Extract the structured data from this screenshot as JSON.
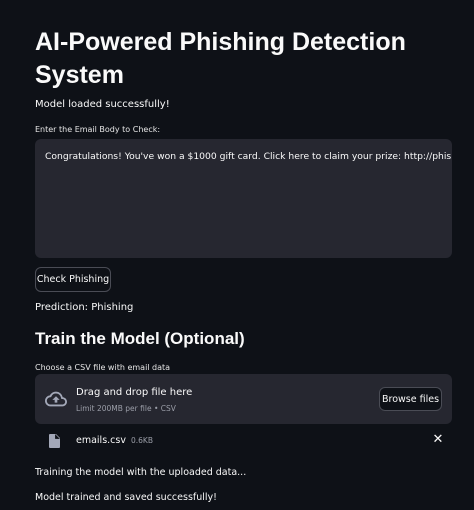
{
  "title": "AI-Powered Phishing Detection System",
  "status": "Model loaded successfully!",
  "email_input": {
    "label": "Enter the Email Body to Check:",
    "value": "Congratulations! You've won a $1000 gift card. Click here to claim your prize: http://phishing.com"
  },
  "check_button": "Check Phishing",
  "prediction": "Prediction: Phishing",
  "train_section": {
    "heading": "Train the Model (Optional)",
    "uploader_label": "Choose a CSV file with email data",
    "dropzone_text": "Drag and drop file here",
    "limit_text": "Limit 200MB per file • CSV",
    "browse_button": "Browse files",
    "file": {
      "name": "emails.csv",
      "size": "0.6KB"
    }
  },
  "messages": {
    "training": "Training the model with the uploaded data...",
    "done": "Model trained and saved successfully!"
  },
  "colors": {
    "background": "#0e1117",
    "surface": "#262730",
    "text": "#fafafa",
    "muted": "#9b9ea8"
  }
}
